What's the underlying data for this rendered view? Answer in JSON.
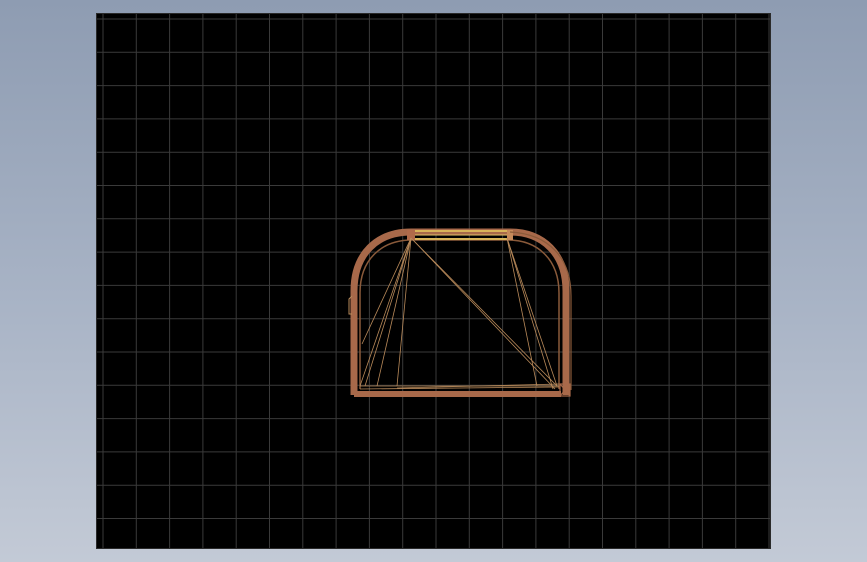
{
  "app": {
    "background_top": "#8e9cb2",
    "background_bottom": "#c3cad6"
  },
  "viewport": {
    "background_color": "#000000",
    "grid_color": "#3a3a3a",
    "grid": true
  },
  "model": {
    "part": "curved-frame-rail",
    "outer_edge_color": "#a8694a",
    "inner_edge_color": "#8a5a3a",
    "highlight_color": "#d8b45a",
    "wire_color": "#b98a5a"
  }
}
